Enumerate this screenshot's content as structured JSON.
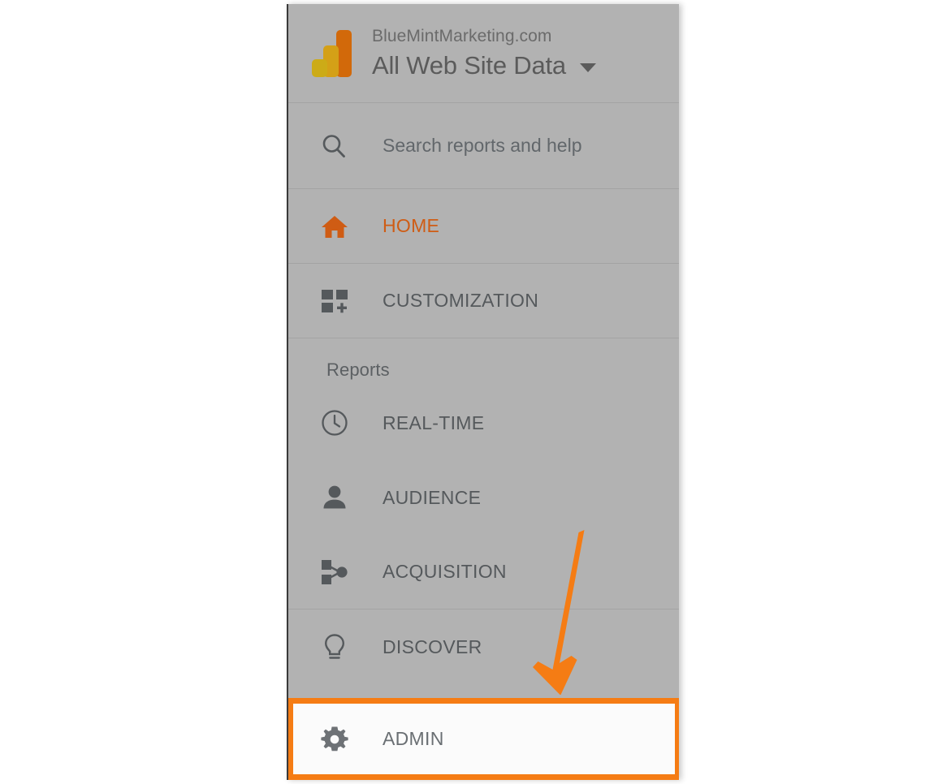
{
  "app": {
    "name": "Google Analytics",
    "accent_orange": "#f57c14",
    "active_item_color": "#cf5c14",
    "panel_background": "#b2b2b2",
    "page_background": "#ffffff"
  },
  "header": {
    "logo_icon": "google-analytics-logo",
    "account_name": "BlueMintMarketing.com",
    "view_name": "All Web Site Data",
    "caret_icon": "chevron-down-icon"
  },
  "search": {
    "icon": "search-icon",
    "placeholder": "Search reports and help",
    "value": ""
  },
  "nav": {
    "primary": [
      {
        "id": "home",
        "label": "HOME",
        "icon": "home-icon",
        "active": true
      },
      {
        "id": "customization",
        "label": "CUSTOMIZATION",
        "icon": "customization-icon",
        "active": false
      }
    ],
    "reports_group_label": "Reports",
    "reports": [
      {
        "id": "real-time",
        "label": "REAL-TIME",
        "icon": "clock-icon",
        "active": false
      },
      {
        "id": "audience",
        "label": "AUDIENCE",
        "icon": "person-icon",
        "active": false
      },
      {
        "id": "acquisition",
        "label": "ACQUISITION",
        "icon": "share-node-icon",
        "active": false
      }
    ],
    "secondary": [
      {
        "id": "discover",
        "label": "DISCOVER",
        "icon": "lightbulb-icon",
        "active": false
      }
    ],
    "admin": {
      "id": "admin",
      "label": "ADMIN",
      "icon": "gear-icon",
      "highlighted": true,
      "highlight_color": "#f57c14"
    }
  },
  "annotation": {
    "arrow_icon": "down-arrow-annotation",
    "arrow_color": "#f57c14",
    "points_to": "ADMIN"
  }
}
